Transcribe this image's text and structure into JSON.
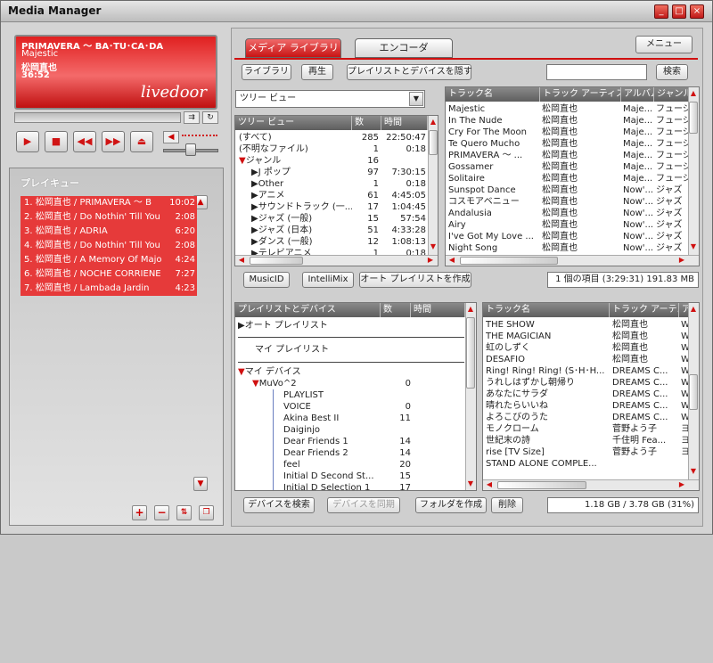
{
  "window": {
    "title": "Media Manager"
  },
  "now_playing": {
    "title": "PRIMAVERA 〜 BA･TU･CA･DA",
    "album": "Majestic",
    "artist": "松岡直也",
    "time": "36:52",
    "logo": "livedoor"
  },
  "play_queue": {
    "header": "プレイキュー",
    "items": [
      {
        "label": "1. 松岡直也 / PRIMAVERA 〜 B",
        "duration": "10:02"
      },
      {
        "label": "2. 松岡直也 / Do Nothin' Till You",
        "duration": "2:08"
      },
      {
        "label": "3. 松岡直也 / ADRIA",
        "duration": "6:20"
      },
      {
        "label": "4. 松岡直也 / Do Nothin' Till You",
        "duration": "2:08"
      },
      {
        "label": "5. 松岡直也 / A Memory Of Majo",
        "duration": "4:24"
      },
      {
        "label": "6. 松岡直也 / NOCHE CORRIENE",
        "duration": "7:27"
      },
      {
        "label": "7. 松岡直也 / Lambada Jardin",
        "duration": "4:23"
      }
    ]
  },
  "tabs": {
    "media_library": "メディア ライブラリ",
    "encoder": "エンコーダ",
    "menu": "メニュー"
  },
  "toolbar": {
    "library": "ライブラリ",
    "play": "再生",
    "hide_playlists": "プレイリストとデバイスを隠す",
    "search": "検索",
    "search_value": ""
  },
  "tree": {
    "view_select": "ツリー ビュー",
    "headers": [
      "ツリー ビュー",
      "数",
      "時間"
    ],
    "rows": [
      {
        "indent": 0,
        "arrow": "",
        "name": "(すべて)",
        "count": "285",
        "time": "22:50:47"
      },
      {
        "indent": 0,
        "arrow": "",
        "name": "(不明なファイル)",
        "count": "1",
        "time": "0:18"
      },
      {
        "indent": 0,
        "arrow": "▼",
        "name": "ジャンル",
        "count": "16",
        "time": ""
      },
      {
        "indent": 1,
        "arrow": "▶",
        "name": "J ポップ",
        "count": "97",
        "time": "7:30:15"
      },
      {
        "indent": 1,
        "arrow": "▶",
        "name": "Other",
        "count": "1",
        "time": "0:18"
      },
      {
        "indent": 1,
        "arrow": "▶",
        "name": "アニメ",
        "count": "61",
        "time": "4:45:05"
      },
      {
        "indent": 1,
        "arrow": "▶",
        "name": "サウンドトラック (一...",
        "count": "17",
        "time": "1:04:45"
      },
      {
        "indent": 1,
        "arrow": "▶",
        "name": "ジャズ (一般)",
        "count": "15",
        "time": "57:54"
      },
      {
        "indent": 1,
        "arrow": "▶",
        "name": "ジャズ (日本)",
        "count": "51",
        "time": "4:33:28"
      },
      {
        "indent": 1,
        "arrow": "▶",
        "name": "ダンス (一般)",
        "count": "12",
        "time": "1:08:13"
      },
      {
        "indent": 1,
        "arrow": "▶",
        "name": "テレビアニメ",
        "count": "1",
        "time": "0:18"
      }
    ]
  },
  "tracks_top": {
    "headers": [
      "トラック名",
      "トラック アーティスト",
      "アルバム",
      "ジャンル"
    ],
    "rows": [
      [
        "Majestic",
        "松岡直也",
        "Maje...",
        "フュージ"
      ],
      [
        "In The Nude",
        "松岡直也",
        "Maje...",
        "フュージ"
      ],
      [
        "Cry For The Moon",
        "松岡直也",
        "Maje...",
        "フュージ"
      ],
      [
        "Te Quero Mucho",
        "松岡直也",
        "Maje...",
        "フュージ"
      ],
      [
        "PRIMAVERA 〜 ...",
        "松岡直也",
        "Maje...",
        "フュージ"
      ],
      [
        "Gossamer",
        "松岡直也",
        "Maje...",
        "フュージ"
      ],
      [
        "Solitaire",
        "松岡直也",
        "Maje...",
        "フュージ"
      ],
      [
        "Sunspot Dance",
        "松岡直也",
        "Now'...",
        "ジャズ"
      ],
      [
        "コスモアベニュー",
        "松岡直也",
        "Now'...",
        "ジャズ"
      ],
      [
        "Andalusia",
        "松岡直也",
        "Now'...",
        "ジャズ"
      ],
      [
        "Airy",
        "松岡直也",
        "Now'...",
        "ジャズ"
      ],
      [
        "I've Got My Love ...",
        "松岡直也",
        "Now'...",
        "ジャズ"
      ],
      [
        "Night Song",
        "松岡直也",
        "Now'...",
        "ジャズ"
      ]
    ]
  },
  "mid_bar": {
    "musicid": "MusicID",
    "intellimix": "IntelliMix",
    "auto_playlist": "オート プレイリストを作成",
    "status": "1 個の項目 (3:29:31) 191.83 MB"
  },
  "devices": {
    "headers": [
      "プレイリストとデバイス",
      "数",
      "時間"
    ],
    "auto_playlist": "オート プレイリスト",
    "my_playlist": "マイ プレイリスト",
    "my_devices": "マイ デバイス",
    "device": {
      "name": "MuVo^2",
      "count": "0"
    },
    "rows": [
      {
        "name": "PLAYLIST",
        "count": ""
      },
      {
        "name": "VOICE",
        "count": "0"
      },
      {
        "name": "Akina Best II",
        "count": "11"
      },
      {
        "name": "Daiginjo",
        "count": ""
      },
      {
        "name": "Dear Friends 1",
        "count": "14"
      },
      {
        "name": "Dear Friends 2",
        "count": "14"
      },
      {
        "name": "feel",
        "count": "20"
      },
      {
        "name": "Initial D Second St...",
        "count": "15"
      },
      {
        "name": "Initial D Selection 1",
        "count": "17"
      }
    ]
  },
  "tracks_bottom": {
    "headers": [
      "トラック名",
      "トラック アーテ...",
      "ア"
    ],
    "rows": [
      [
        "THE SHOW",
        "松岡直也",
        "W"
      ],
      [
        "THE MAGICIAN",
        "松岡直也",
        "W"
      ],
      [
        "虹のしずく",
        "松岡直也",
        "W"
      ],
      [
        "DESAFIO",
        "松岡直也",
        "W"
      ],
      [
        "Ring! Ring! Ring! (S･H･H...",
        "DREAMS C...",
        "W"
      ],
      [
        "うれしはずかし朝帰り",
        "DREAMS C...",
        "W"
      ],
      [
        "あなたにサラダ",
        "DREAMS C...",
        "W"
      ],
      [
        "晴れたらいいね",
        "DREAMS C...",
        "W"
      ],
      [
        "よろこびのうた",
        "DREAMS C...",
        "W"
      ],
      [
        "モノクローム",
        "菅野よう子",
        "ヨ"
      ],
      [
        "世紀末の詩",
        "千住明 Fea...",
        "ヨ"
      ],
      [
        "rise [TV Size]",
        "菅野よう子",
        "ヨ"
      ],
      [
        "STAND ALONE COMPLE...",
        "",
        " "
      ]
    ]
  },
  "bottom_bar": {
    "search_devices": "デバイスを検索",
    "sync_device": "デバイスを同期",
    "create_folder": "フォルダを作成",
    "delete": "削除",
    "status": "1.18 GB / 3.78 GB (31%)"
  }
}
